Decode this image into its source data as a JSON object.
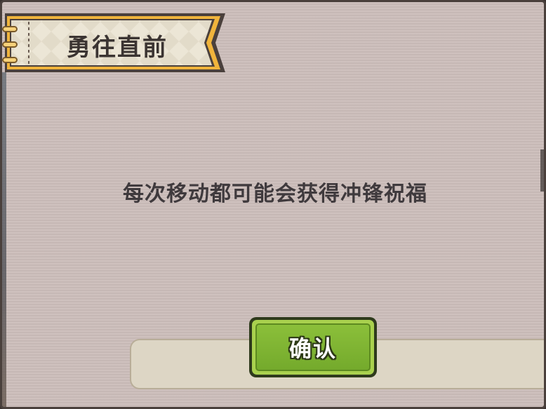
{
  "dialog": {
    "title": "勇往直前",
    "message": "每次移动都可能会获得冲锋祝福",
    "confirm_label": "确认"
  },
  "icons": {
    "title_ribbon": "ribbon-banner",
    "binder_rings": "binder-ring-icon"
  },
  "colors": {
    "panel_bg": "#cbbcb9",
    "ribbon_border": "#f0b43c",
    "ribbon_fill": "#ece6d6",
    "button_green": "#7db233",
    "text_dark": "#3f3a3d"
  }
}
